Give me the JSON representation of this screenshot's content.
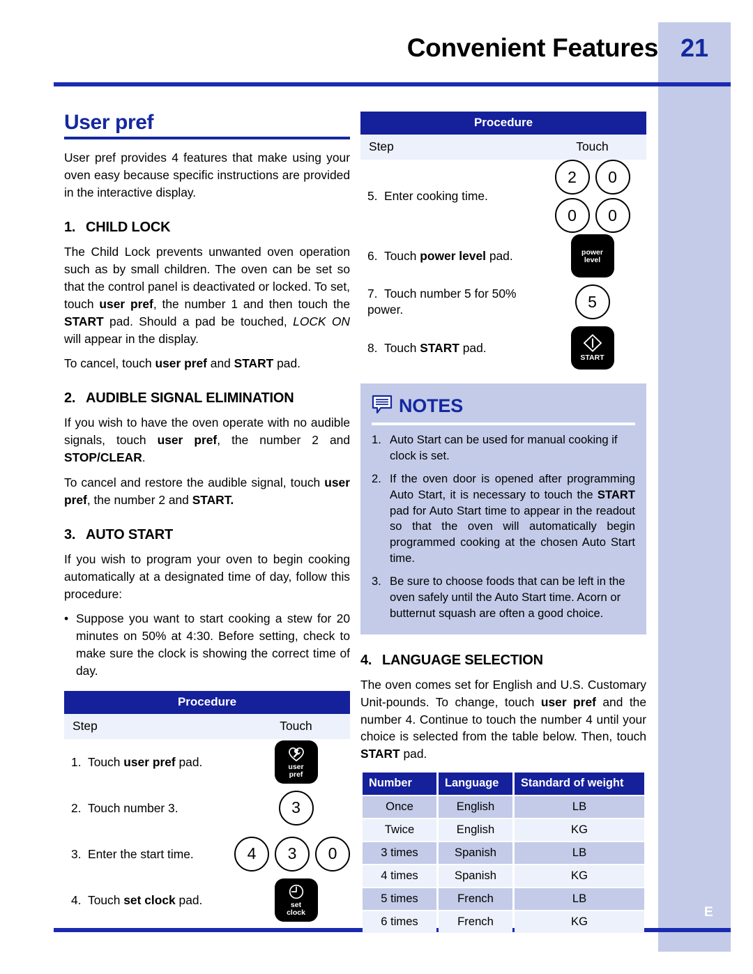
{
  "header": {
    "title": "Convenient Features",
    "page_number": "21",
    "side_letter": "E"
  },
  "left_column": {
    "title": "User pref",
    "intro": "User pref provides 4 features that make using your oven easy because specific instructions are provided in the interactive display.",
    "sections": [
      {
        "number": "1.",
        "heading": "CHILD LOCK",
        "paragraph_1_html": "The Child Lock prevents unwanted oven operation such as by small children. The oven can be set so that the control panel is deactivated or locked. To set, touch <b>user pref</b>, the number 1 and then touch the <b>START</b> pad. Should a pad be touched, <i>LOCK ON</i> will appear in the display.",
        "paragraph_2_html": "To cancel, touch <b>user pref</b> and <b>START</b> pad."
      },
      {
        "number": "2.",
        "heading": "AUDIBLE SIGNAL ELIMINATION",
        "paragraph_1_html": "If you wish to have the oven operate with no audible signals, touch <b>user pref</b>, the number 2 and <b>STOP/CLEAR</b>.",
        "paragraph_2_html": "To cancel and restore the audible signal, touch <b>user pref</b>, the number 2 and <b>START.</b>"
      },
      {
        "number": "3.",
        "heading": "AUTO START",
        "paragraph_1_html": "If you wish to program your oven to begin cooking automatically at a designated time of day, follow this procedure:",
        "bullet_html": "Suppose you want to start cooking a stew for 20 minutes on 50% at 4:30. Before setting, check to make sure the clock is showing the correct time of day.",
        "bullet_marker": "•"
      }
    ]
  },
  "procedure_left": {
    "header": "Procedure",
    "col_step": "Step",
    "col_touch": "Touch",
    "rows": [
      {
        "num": "1.",
        "text_html": "Touch <b>user pref</b> pad.",
        "touch": {
          "kind": "pad",
          "icon": "user-pref-icon",
          "label_line1": "user",
          "label_line2": "pref"
        }
      },
      {
        "num": "2.",
        "text_html": "Touch number 3.",
        "touch": {
          "kind": "circles",
          "values": [
            "3"
          ]
        }
      },
      {
        "num": "3.",
        "text_html": "Enter the start time.",
        "touch": {
          "kind": "circles",
          "values": [
            "4",
            "3",
            "0"
          ]
        }
      },
      {
        "num": "4.",
        "text_html": "Touch <b>set clock</b> pad.",
        "touch": {
          "kind": "pad",
          "icon": "set-clock-icon",
          "label_line1": "set",
          "label_line2": "clock"
        }
      }
    ]
  },
  "procedure_right": {
    "header": "Procedure",
    "col_step": "Step",
    "col_touch": "Touch",
    "rows": [
      {
        "num": "5.",
        "text_html": "Enter cooking time.",
        "touch": {
          "kind": "circle-grid",
          "rows": [
            [
              "2",
              "0"
            ],
            [
              "0",
              "0"
            ]
          ]
        }
      },
      {
        "num": "6.",
        "text_html": "Touch <b>power level</b> pad.",
        "touch": {
          "kind": "pad",
          "icon": "none",
          "label_line1": "power",
          "label_line2": "level"
        }
      },
      {
        "num": "7.",
        "text_html": "Touch number 5 for 50% power.",
        "touch": {
          "kind": "circles",
          "values": [
            "5"
          ]
        }
      },
      {
        "num": "8.",
        "text_html": "Touch <b>START</b> pad.",
        "touch": {
          "kind": "pad",
          "icon": "start-diamond-icon",
          "label_line1": "START",
          "label_line2": ""
        }
      }
    ]
  },
  "notes": {
    "title": "NOTES",
    "icon": "speech-bubble-icon",
    "items": [
      {
        "num": "1.",
        "text_html": "Auto Start can be used for manual cooking if clock is set.",
        "justify": false
      },
      {
        "num": "2.",
        "text_html": "If the oven door is opened after programming Auto Start, it is necessary to touch the <b>START</b> pad for Auto Start time to appear in the readout so that the oven will automatically begin programmed cooking at the chosen Auto Start time.",
        "justify": true
      },
      {
        "num": "3.",
        "text_html": "Be sure to choose foods that can be left in the oven safely until the Auto Start time. Acorn or butternut squash are often a good choice.",
        "justify": false
      }
    ]
  },
  "language_section": {
    "number": "4.",
    "heading": "LANGUAGE SELECTION",
    "paragraph_html": "The oven comes set for English and U.S. Customary Unit-pounds. To change, touch <b>user pref</b> and the number 4. Continue to touch the number 4 until your choice is selected from the table below. Then, touch <b>START</b> pad."
  },
  "language_table": {
    "columns": [
      "Number",
      "Language",
      "Standard of weight"
    ],
    "rows": [
      [
        "Once",
        "English",
        "LB"
      ],
      [
        "Twice",
        "English",
        "KG"
      ],
      [
        "3 times",
        "Spanish",
        "LB"
      ],
      [
        "4 times",
        "Spanish",
        "KG"
      ],
      [
        "5 times",
        "French",
        "LB"
      ],
      [
        "6 times",
        "French",
        "KG"
      ]
    ]
  },
  "colors": {
    "brand_blue": "#1428a0",
    "header_bar_blue": "#15209b",
    "tint_light": "#edf1fb",
    "tint_medium": "#c3cbe8",
    "rule_blue": "#1b2bb0"
  }
}
